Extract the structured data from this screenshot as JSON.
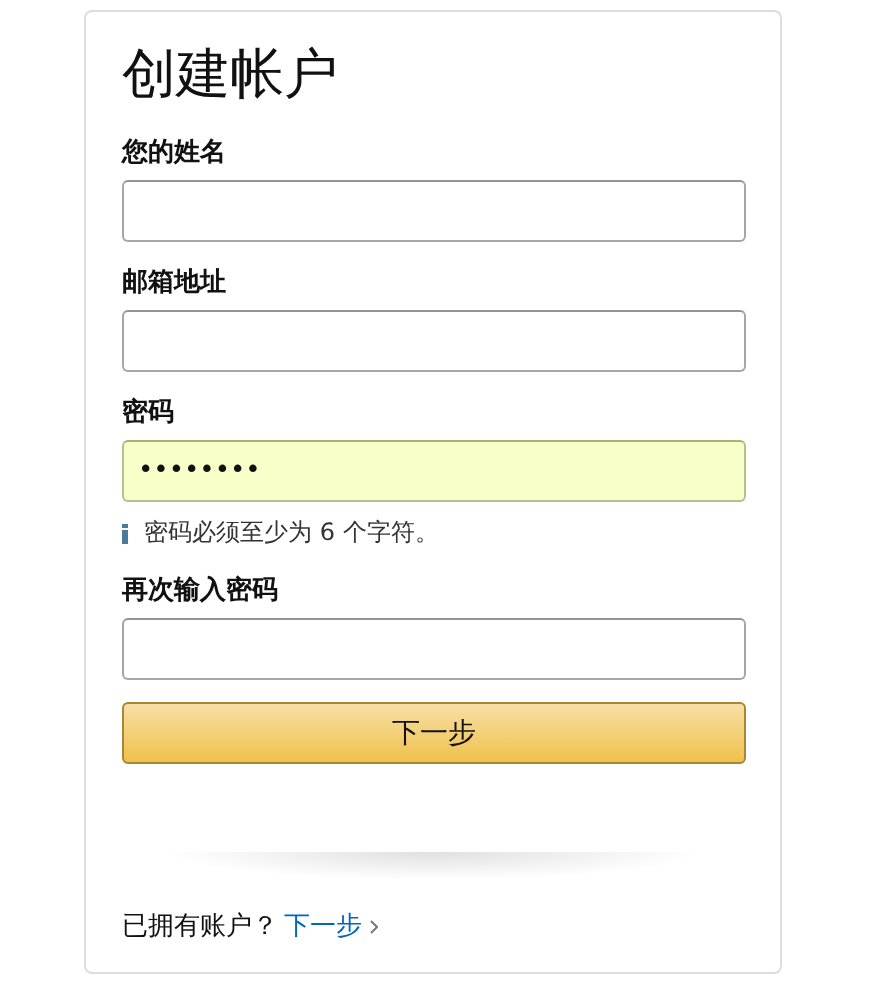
{
  "title": "创建帐户",
  "fields": [
    {
      "label": "您的姓名",
      "highlighted": false
    },
    {
      "label": "邮箱地址",
      "highlighted": false
    },
    {
      "label": "密码",
      "value": "••••••••",
      "highlighted": true,
      "hint": "密码必须至少为 6 个字符。"
    },
    {
      "label": "再次输入密码",
      "highlighted": false
    }
  ],
  "submit_button": "下一步",
  "footer": {
    "text": "已拥有账户？",
    "link": "下一步"
  }
}
